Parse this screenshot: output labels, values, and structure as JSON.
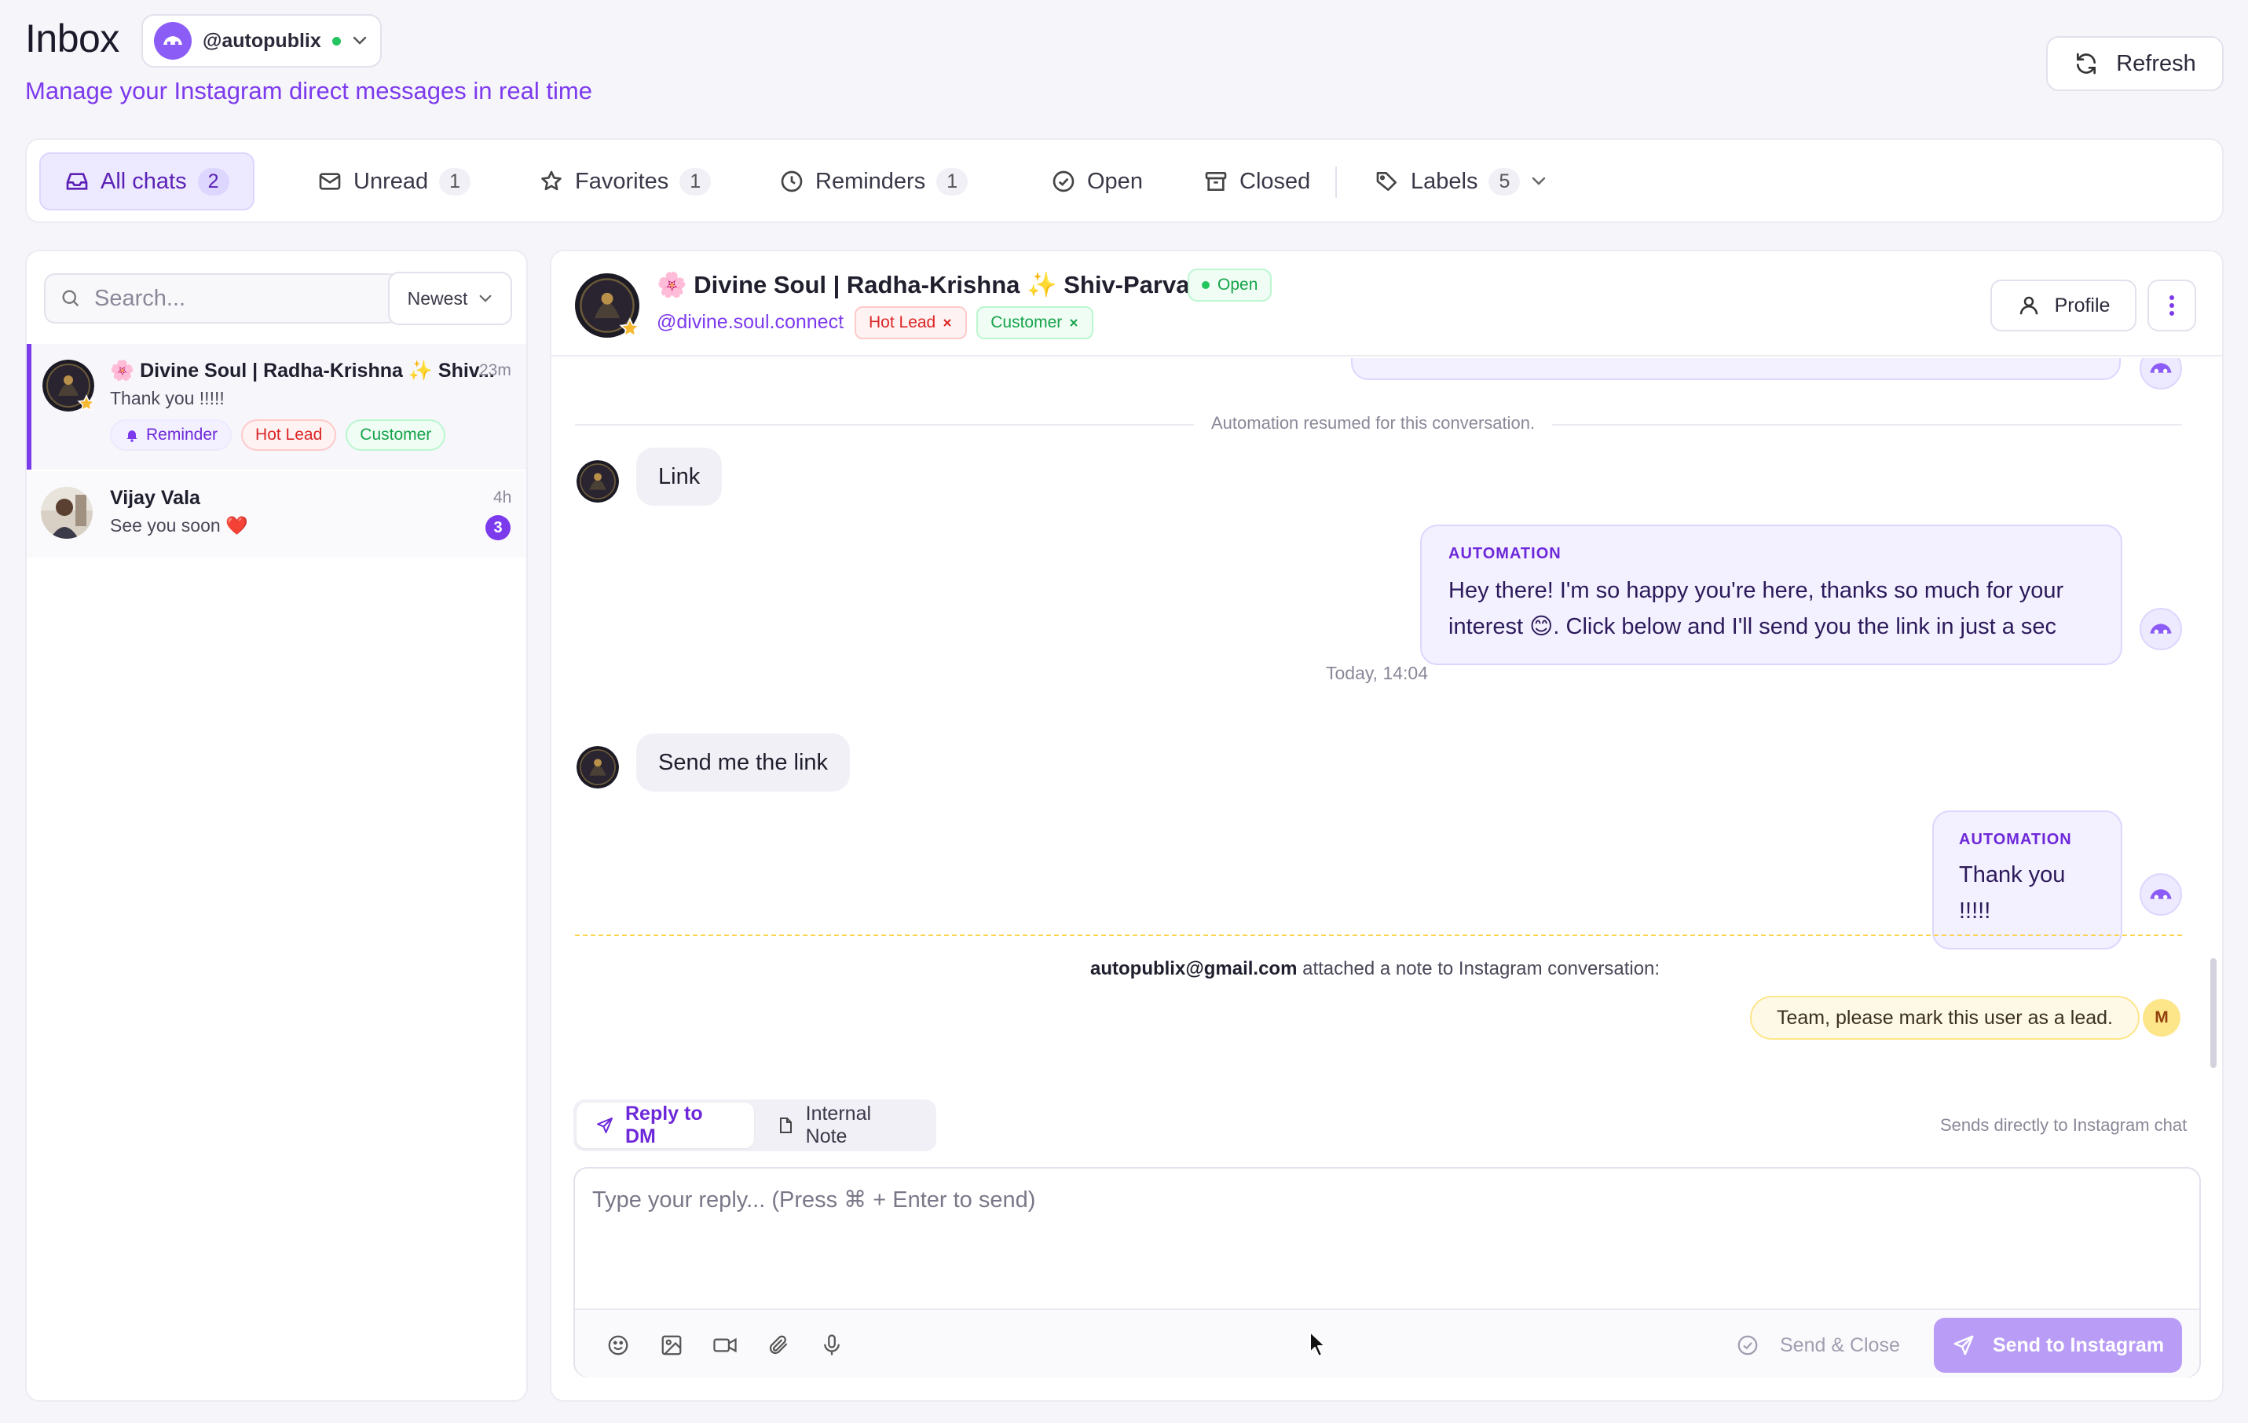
{
  "header": {
    "title": "Inbox",
    "account": "@autopublix",
    "subtitle": "Manage your Instagram direct messages in real time",
    "refresh_label": "Refresh"
  },
  "filters": [
    {
      "label": "All chats",
      "count": "2",
      "icon": "inbox-icon",
      "active": true
    },
    {
      "label": "Unread",
      "count": "1",
      "icon": "mail-icon"
    },
    {
      "label": "Favorites",
      "count": "1",
      "icon": "star-icon"
    },
    {
      "label": "Reminders",
      "count": "1",
      "icon": "clock-icon"
    },
    {
      "label": "Open",
      "count": "",
      "icon": "check-circle-icon"
    },
    {
      "label": "Closed",
      "count": "",
      "icon": "archive-icon"
    },
    {
      "label": "Labels",
      "count": "5",
      "icon": "tag-icon"
    }
  ],
  "sidebar": {
    "search_placeholder": "Search...",
    "sort_label": "Newest",
    "chats": [
      {
        "name": "🌸 Divine Soul | Radha-Krishna ✨ Shiv...",
        "time": "23m",
        "preview": "Thank you !!!!!",
        "tags": {
          "reminder": "Reminder",
          "hot": "Hot Lead",
          "customer": "Customer"
        }
      },
      {
        "name": "Vijay Vala",
        "time": "4h",
        "preview": "See you soon ❤️",
        "unread": "3"
      }
    ]
  },
  "conversation": {
    "name": "🌸 Divine Soul | Radha-Krishna ✨ Shiv-Parvati 💖",
    "status": "Open",
    "handle": "@divine.soul.connect",
    "tags": {
      "hot": "Hot Lead",
      "customer": "Customer"
    },
    "profile_label": "Profile",
    "system_message": "Automation resumed for this conversation.",
    "messages": {
      "in1": "Link",
      "auto1_label": "AUTOMATION",
      "auto1_text": "Hey there! I'm so happy you're here, thanks so much for your interest 😊. Click below and I'll send you the link in just a sec",
      "day_separator": "Today, 14:04",
      "in2": "Send me the link",
      "auto2_label": "AUTOMATION",
      "auto2_text": "Thank you !!!!!"
    },
    "note": {
      "author": "autopublix@gmail.com",
      "caption_rest": " attached a note to Instagram conversation:",
      "text": "Team, please mark this user as a lead.",
      "avatar_initial": "M"
    }
  },
  "composer": {
    "tab_reply": "Reply to DM",
    "tab_note": "Internal Note",
    "hint": "Sends directly to Instagram chat",
    "placeholder": "Type your reply... (Press ⌘ + Enter to send)",
    "send_close_label": "Send & Close",
    "send_label": "Send to Instagram"
  },
  "colors": {
    "accent": "#7c3aed",
    "hot_lead": "#dc2626",
    "customer": "#16a34a",
    "note": "#fde68a"
  }
}
